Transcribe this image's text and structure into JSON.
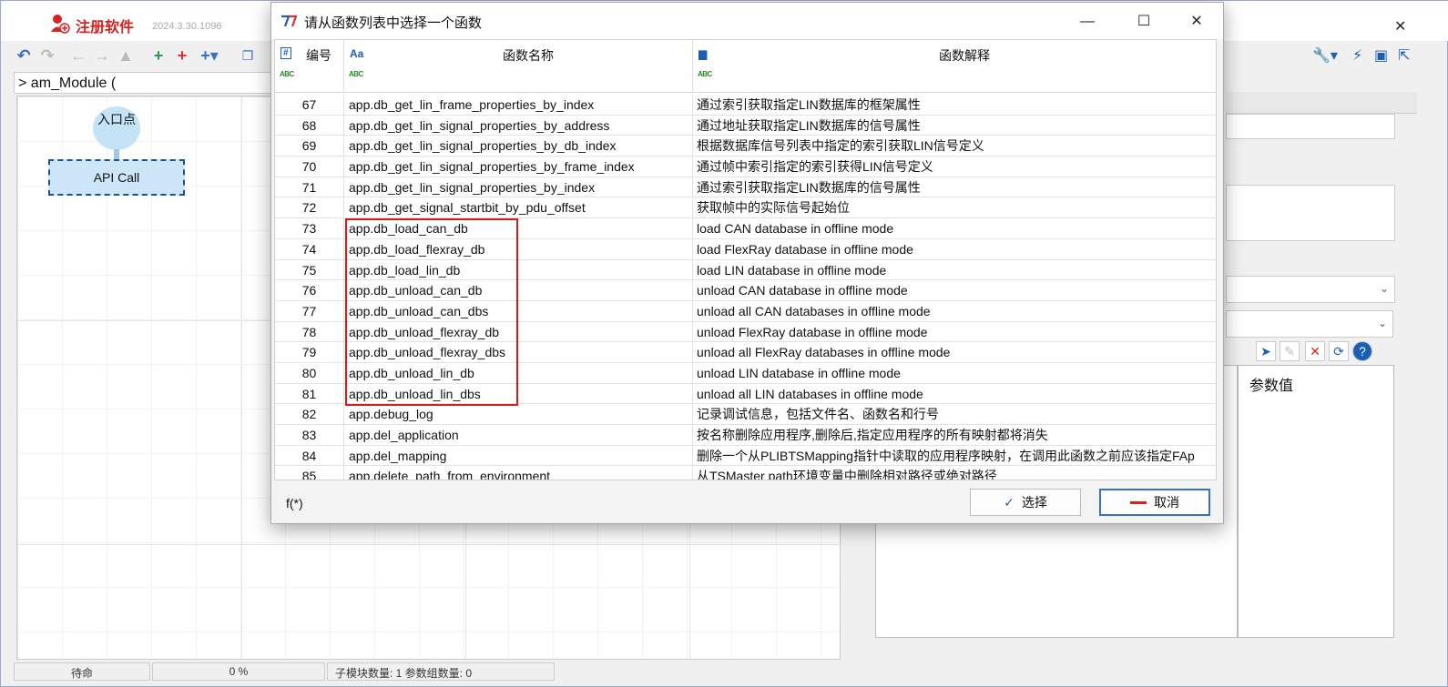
{
  "main": {
    "app_name": "注册软件",
    "version": "2024.3.30.1096",
    "module_tab": "> am_Module (",
    "entry_node": "入口点",
    "api_node": "API Call",
    "param_value_label": "参数值",
    "status": [
      "待命",
      "0 %",
      "子模块数量: 1  参数组数量: 0"
    ]
  },
  "dialog": {
    "title": "请从函数列表中选择一个函数",
    "columns": {
      "num": "编号",
      "name": "函数名称",
      "desc": "函数解释"
    },
    "rows": [
      {
        "num": "67",
        "name": "app.db_get_lin_frame_properties_by_index",
        "desc": "通过索引获取指定LIN数据库的框架属性"
      },
      {
        "num": "68",
        "name": "app.db_get_lin_signal_properties_by_address",
        "desc": "通过地址获取指定LIN数据库的信号属性"
      },
      {
        "num": "69",
        "name": "app.db_get_lin_signal_properties_by_db_index",
        "desc": "根据数据库信号列表中指定的索引获取LIN信号定义"
      },
      {
        "num": "70",
        "name": "app.db_get_lin_signal_properties_by_frame_index",
        "desc": "通过帧中索引指定的索引获得LIN信号定义"
      },
      {
        "num": "71",
        "name": "app.db_get_lin_signal_properties_by_index",
        "desc": "通过索引获取指定LIN数据库的信号属性"
      },
      {
        "num": "72",
        "name": "app.db_get_signal_startbit_by_pdu_offset",
        "desc": "获取帧中的实际信号起始位"
      },
      {
        "num": "73",
        "name": "app.db_load_can_db",
        "desc": "load CAN database in offline mode"
      },
      {
        "num": "74",
        "name": "app.db_load_flexray_db",
        "desc": "load FlexRay database in offline mode"
      },
      {
        "num": "75",
        "name": "app.db_load_lin_db",
        "desc": "load LIN database in offline mode"
      },
      {
        "num": "76",
        "name": "app.db_unload_can_db",
        "desc": "unload CAN database in offline mode"
      },
      {
        "num": "77",
        "name": "app.db_unload_can_dbs",
        "desc": "unload all CAN databases in offline mode"
      },
      {
        "num": "78",
        "name": "app.db_unload_flexray_db",
        "desc": "unload FlexRay database in offline mode"
      },
      {
        "num": "79",
        "name": "app.db_unload_flexray_dbs",
        "desc": "unload all FlexRay databases in offline mode"
      },
      {
        "num": "80",
        "name": "app.db_unload_lin_db",
        "desc": "unload LIN database in offline mode"
      },
      {
        "num": "81",
        "name": "app.db_unload_lin_dbs",
        "desc": "unload all LIN databases in offline mode"
      },
      {
        "num": "82",
        "name": "app.debug_log",
        "desc": "记录调试信息，包括文件名、函数名和行号"
      },
      {
        "num": "83",
        "name": "app.del_application",
        "desc": "按名称删除应用程序,删除后,指定应用程序的所有映射都将消失"
      },
      {
        "num": "84",
        "name": "app.del_mapping",
        "desc": "删除一个从PLIBTSMapping指针中读取的应用程序映射，在调用此函数之前应该指定FAp"
      },
      {
        "num": "85",
        "name": "app.delete_path_from_environment",
        "desc": "从TSMaster path环境变量中删除相对路径或绝对路径"
      }
    ],
    "fx_label": "f(*)",
    "select_button": "选择",
    "cancel_button": "取消"
  }
}
